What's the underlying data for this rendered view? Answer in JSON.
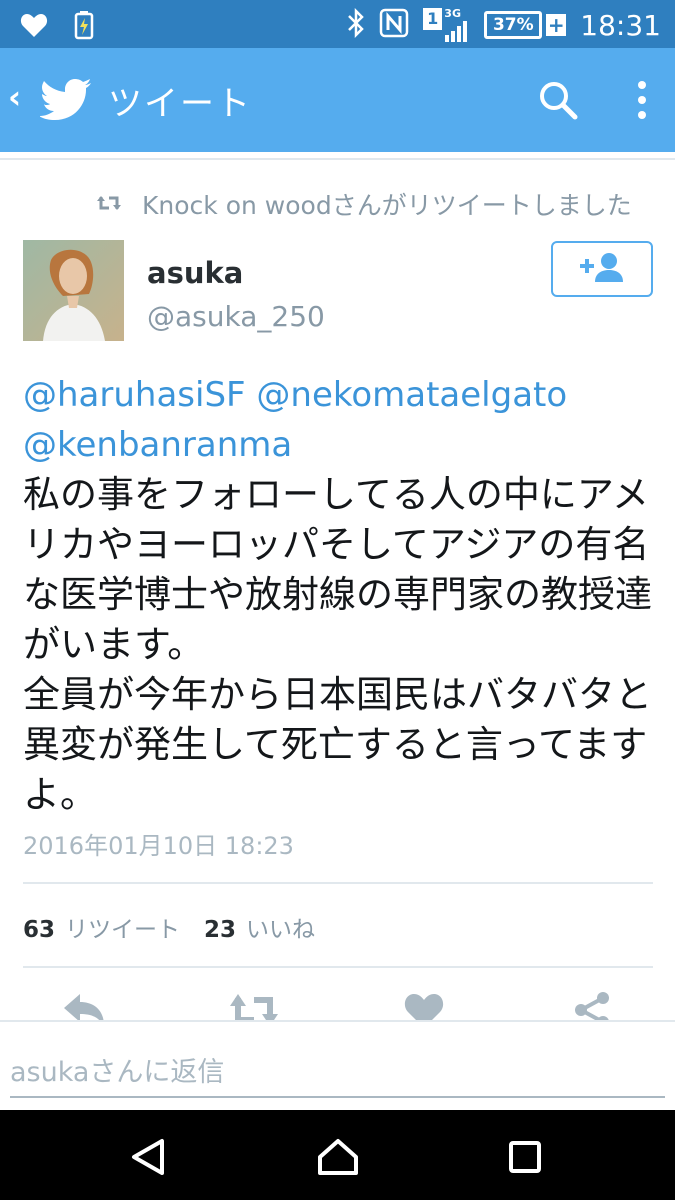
{
  "status_bar": {
    "time": "18:31",
    "battery": "37%",
    "signal_type": "3G",
    "sim_slot": "1"
  },
  "app_bar": {
    "title": "ツイート"
  },
  "retweet_context": {
    "text": "Knock on woodさんがリツイートしました"
  },
  "author": {
    "name": "asuka",
    "handle": "@asuka_250"
  },
  "tweet": {
    "mentions": "@haruhasiSF @nekomataelgato @kenbanranma",
    "body": "私の事をフォローしてる人の中にアメリカやヨーロッパそしてアジアの有名な医学博士や放射線の専門家の教授達がいます。\n全員が今年から日本国民はバタバタと異変が発生して死亡すると言ってますよ。",
    "timestamp": "2016年01月10日 18:23"
  },
  "stats": {
    "retweets_count": "63",
    "retweets_label": "リツイート",
    "likes_count": "23",
    "likes_label": "いいね"
  },
  "reply": {
    "placeholder": "asukaさんに返信"
  },
  "colors": {
    "status_bar": "#2f7fbf",
    "app_bar": "#55acee",
    "link": "#3b94d9",
    "muted": "#8899a6"
  }
}
